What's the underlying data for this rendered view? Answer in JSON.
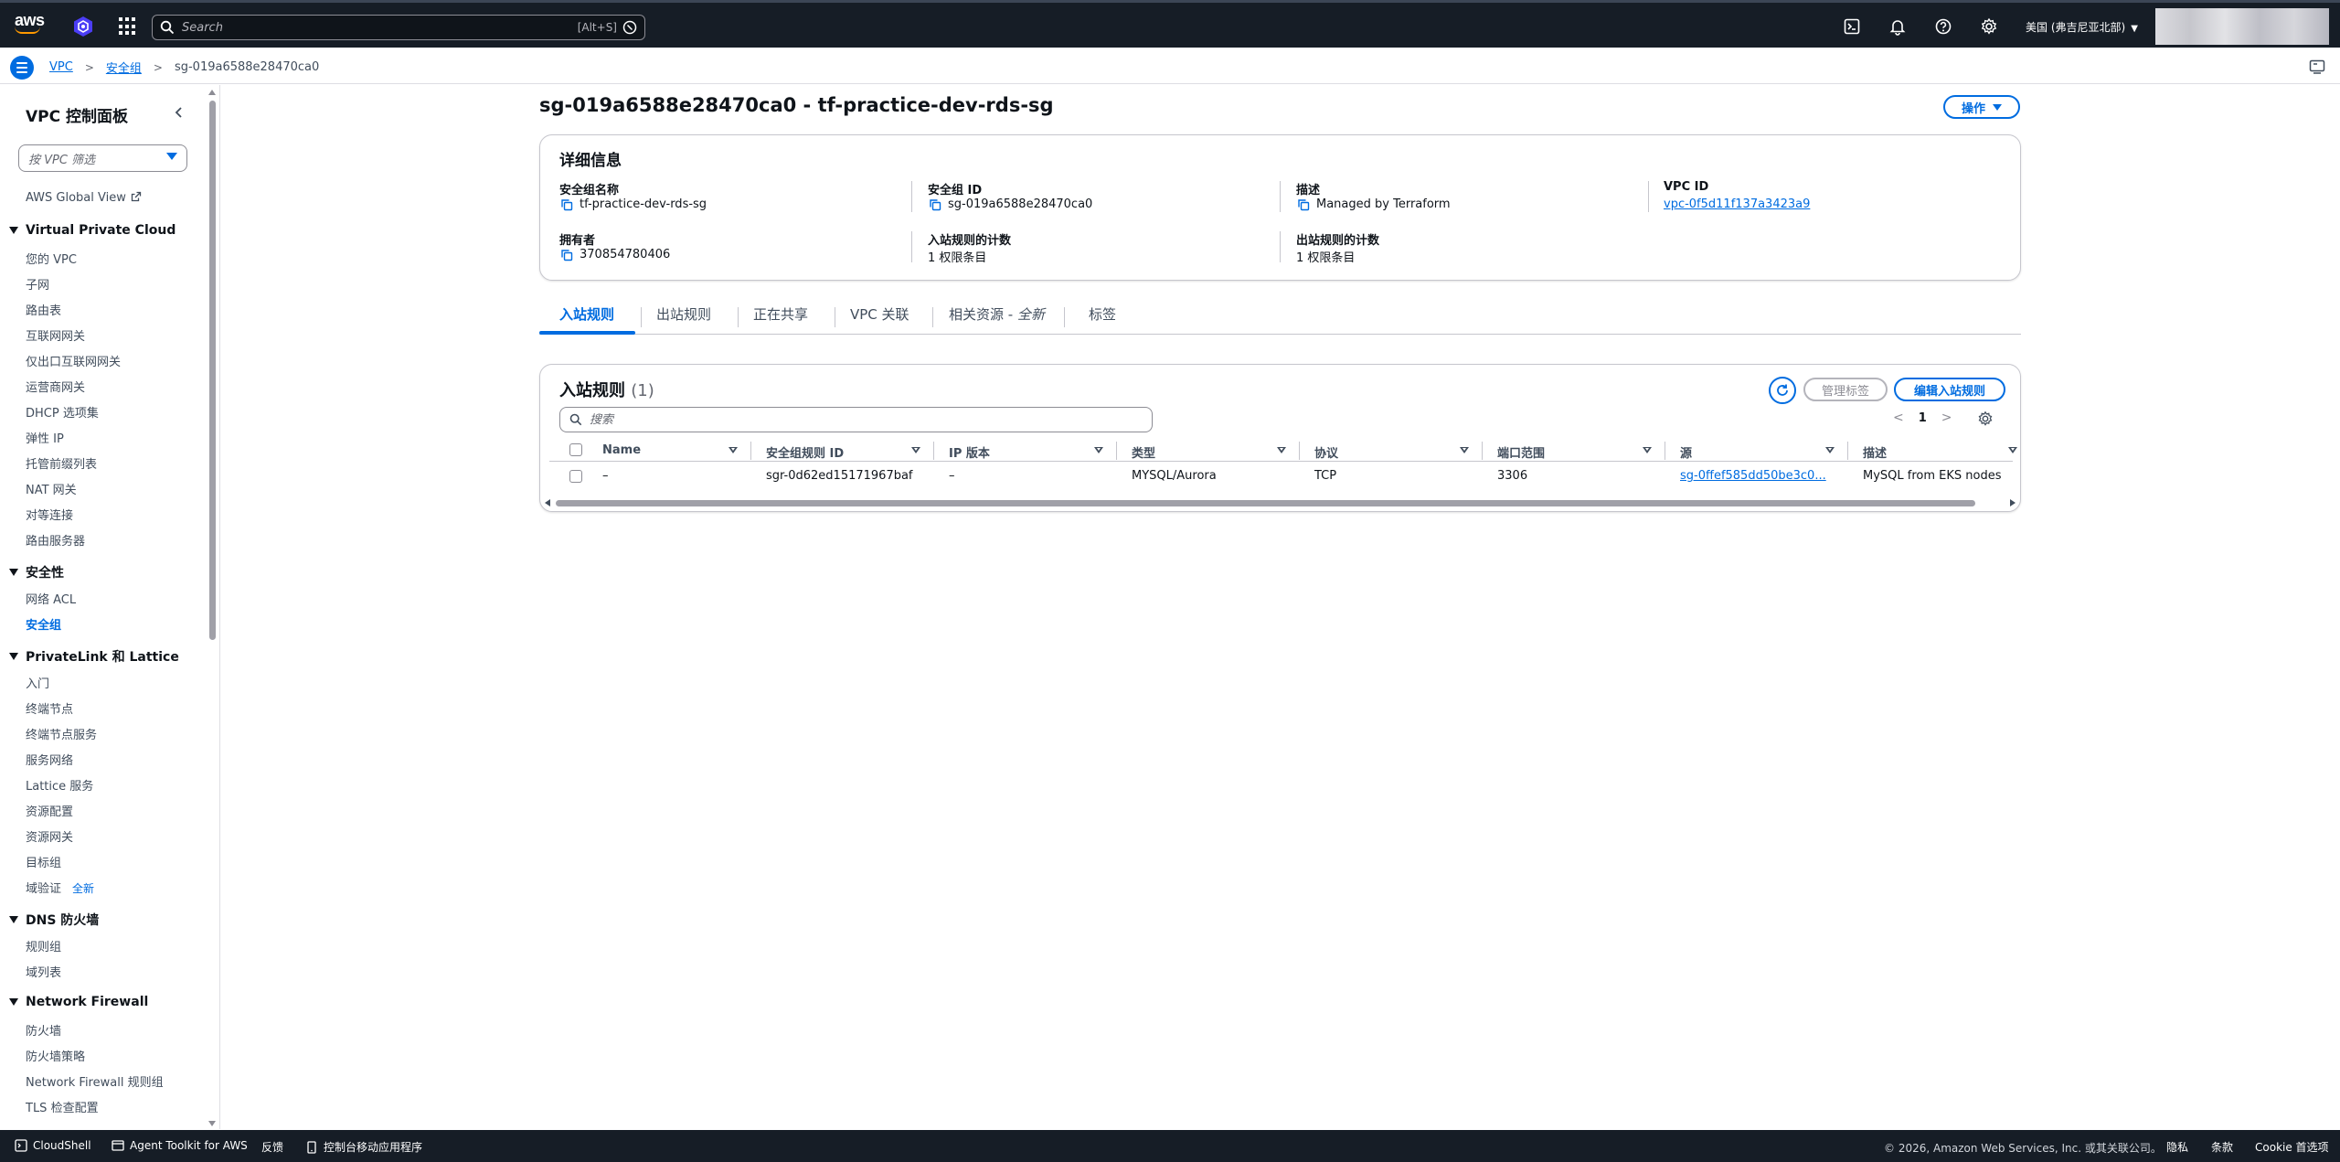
{
  "topnav": {
    "search_placeholder": "Search",
    "search_shortcut": "[Alt+S]",
    "region": "美国 (弗吉尼亚北部)",
    "icons": [
      "cloudshell-icon",
      "notifications-bell-icon",
      "help-icon",
      "settings-gear-icon"
    ]
  },
  "breadcrumb": {
    "items": [
      "VPC",
      "安全组"
    ],
    "current": "sg-019a6588e28470ca0"
  },
  "sidenav": {
    "title": "VPC 控制面板",
    "filter_placeholder": "按 VPC 筛选",
    "global_view": "AWS Global View",
    "vpc_section": "Virtual Private Cloud",
    "vpc_items": [
      "您的 VPC",
      "子网",
      "路由表",
      "互联网网关",
      "仅出口互联网网关",
      "运营商网关",
      "DHCP 选项集",
      "弹性 IP",
      "托管前缀列表",
      "NAT 网关",
      "对等连接",
      "路由服务器"
    ],
    "security_section": "安全性",
    "security_items": [
      "网络 ACL",
      "安全组"
    ],
    "privatelink_section": "PrivateLink 和 Lattice",
    "privatelink_items": [
      "入门",
      "终端节点",
      "终端节点服务",
      "服务网络",
      "Lattice 服务",
      "资源配置",
      "资源网关",
      "目标组",
      "域验证"
    ],
    "new_badge": "全新",
    "dns_section": "DNS 防火墙",
    "dns_items": [
      "规则组",
      "域列表"
    ],
    "firewall_section": "Network Firewall",
    "firewall_items": [
      "防火墙",
      "防火墙策略",
      "Network Firewall 规则组",
      "TLS 检查配置"
    ]
  },
  "page": {
    "title": "sg-019a6588e28470ca0 - tf-practice-dev-rds-sg",
    "actions_label": "操作"
  },
  "details": {
    "heading": "详细信息",
    "fields": [
      {
        "label": "安全组名称",
        "value": "tf-practice-dev-rds-sg"
      },
      {
        "label": "安全组 ID",
        "value": "sg-019a6588e28470ca0"
      },
      {
        "label": "描述",
        "value": "Managed by Terraform"
      },
      {
        "label": "VPC ID",
        "value": "vpc-0f5d11f137a3423a9"
      },
      {
        "label": "拥有者",
        "value": "370854780406"
      },
      {
        "label": "入站规则的计数",
        "value": "1 权限条目"
      },
      {
        "label": "出站规则的计数",
        "value": "1 权限条目"
      }
    ]
  },
  "tabs": {
    "inbound": "入站规则",
    "outbound": "出站规则",
    "sharing": "正在共享",
    "vpc_assoc": "VPC 关联",
    "related_prefix": "相关资源 - ",
    "related_new": "全新",
    "tags": "标签"
  },
  "rules": {
    "title": "入站规则",
    "count": "(1)",
    "manage_tags": "管理标签",
    "edit_rules": "编辑入站规则",
    "search_placeholder": "搜索",
    "page_number": "1",
    "columns": [
      "Name",
      "安全组规则 ID",
      "IP 版本",
      "类型",
      "协议",
      "端口范围",
      "源",
      "描述"
    ],
    "rows": [
      [
        "–",
        "sgr-0d62ed15171967baf",
        "–",
        "MYSQL/Aurora",
        "TCP",
        "3306",
        "sg-0ffef585dd50be3c0...",
        "MySQL from EKS nodes"
      ]
    ]
  },
  "footer": {
    "cloudshell": "CloudShell",
    "agent_toolkit": "Agent Toolkit for AWS",
    "feedback": "反馈",
    "mobile_app": "控制台移动应用程序",
    "copyright": "© 2026, Amazon Web Services, Inc. 或其关联公司。",
    "privacy": "隐私",
    "terms": "条款",
    "cookie": "Cookie 首选项"
  },
  "colors": {
    "nav_bg": "#161d26",
    "accent": "#006ce0",
    "aws_orange": "#ff9900"
  }
}
